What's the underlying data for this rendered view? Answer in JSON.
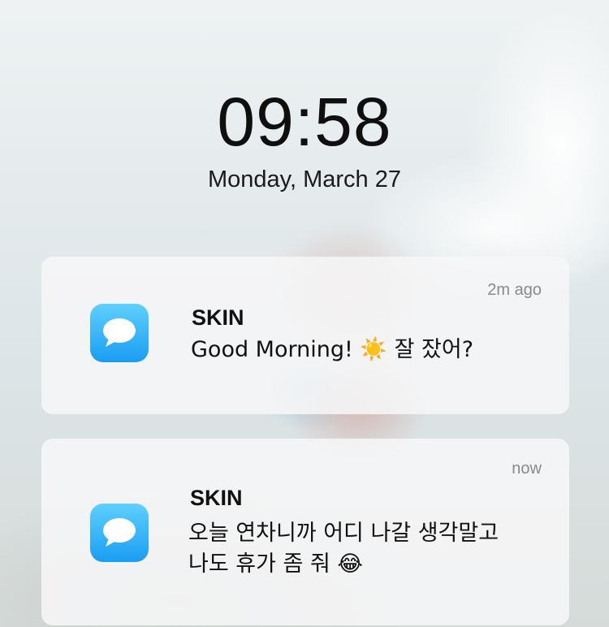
{
  "lockscreen": {
    "time": "09:58",
    "date": "Monday, March 27"
  },
  "notifications": [
    {
      "app_icon": "messages-bubble-icon",
      "sender": "SKIN",
      "time_ago": "2m ago",
      "lines": [
        "Good Morning! ☀️ 잘 잤어?"
      ]
    },
    {
      "app_icon": "messages-bubble-icon",
      "sender": "SKIN",
      "time_ago": "now",
      "lines": [
        "오늘 연차니까 어디 나갈 생각말고",
        "나도 휴가 좀 줘 😂"
      ]
    }
  ],
  "colors": {
    "icon_top": "#5fd0ff",
    "icon_bottom": "#1a9df2",
    "card_bg": "#f6f6f7",
    "muted_text": "#8a8a8e"
  }
}
